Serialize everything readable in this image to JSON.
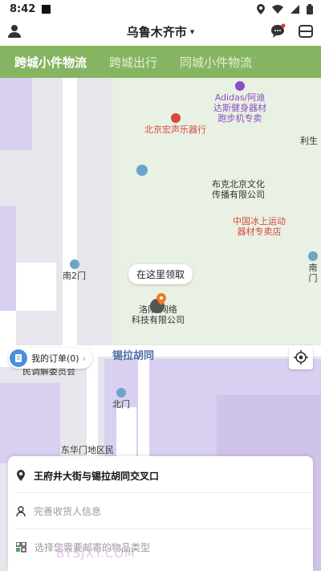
{
  "status_bar": {
    "time": "8:42"
  },
  "header": {
    "city": "乌鲁木齐市"
  },
  "tabs": [
    {
      "label": "跨城小件物流",
      "active": true
    },
    {
      "label": "跨城出行",
      "active": false
    },
    {
      "label": "同城小件物流",
      "active": false
    }
  ],
  "map": {
    "pois": {
      "adidas": "Adidas/阿迪\n达斯健身器材\n跑步机专卖",
      "music": "北京宏声乐器行",
      "lisheng": "利生",
      "bukebeijing": "布克北京文化\n传播有限公司",
      "icesport": "中国冰上运动\n器材专卖店",
      "south2": "南2门",
      "southgate": "南门",
      "luoyang": "洛阳  网络\n科技有限公司",
      "dhm": "东华门街通人\n民调解委员会",
      "north": "北门",
      "dhm_area": "东华门地区民"
    },
    "road": "锡拉胡同",
    "pickup_hint": "在这里领取"
  },
  "orders": {
    "label": "我的订单(0)"
  },
  "form": {
    "address": "王府井大街与锡拉胡同交叉口",
    "receiver_placeholder": "完善收货人信息",
    "item_type_placeholder": "选择您需要邮寄的物品类型"
  },
  "watermark": "BYSJXY.COM",
  "colors": {
    "tab_bar": "#86b562",
    "accent_pin": "#f07a1d",
    "road_label": "#4a6fa5"
  }
}
